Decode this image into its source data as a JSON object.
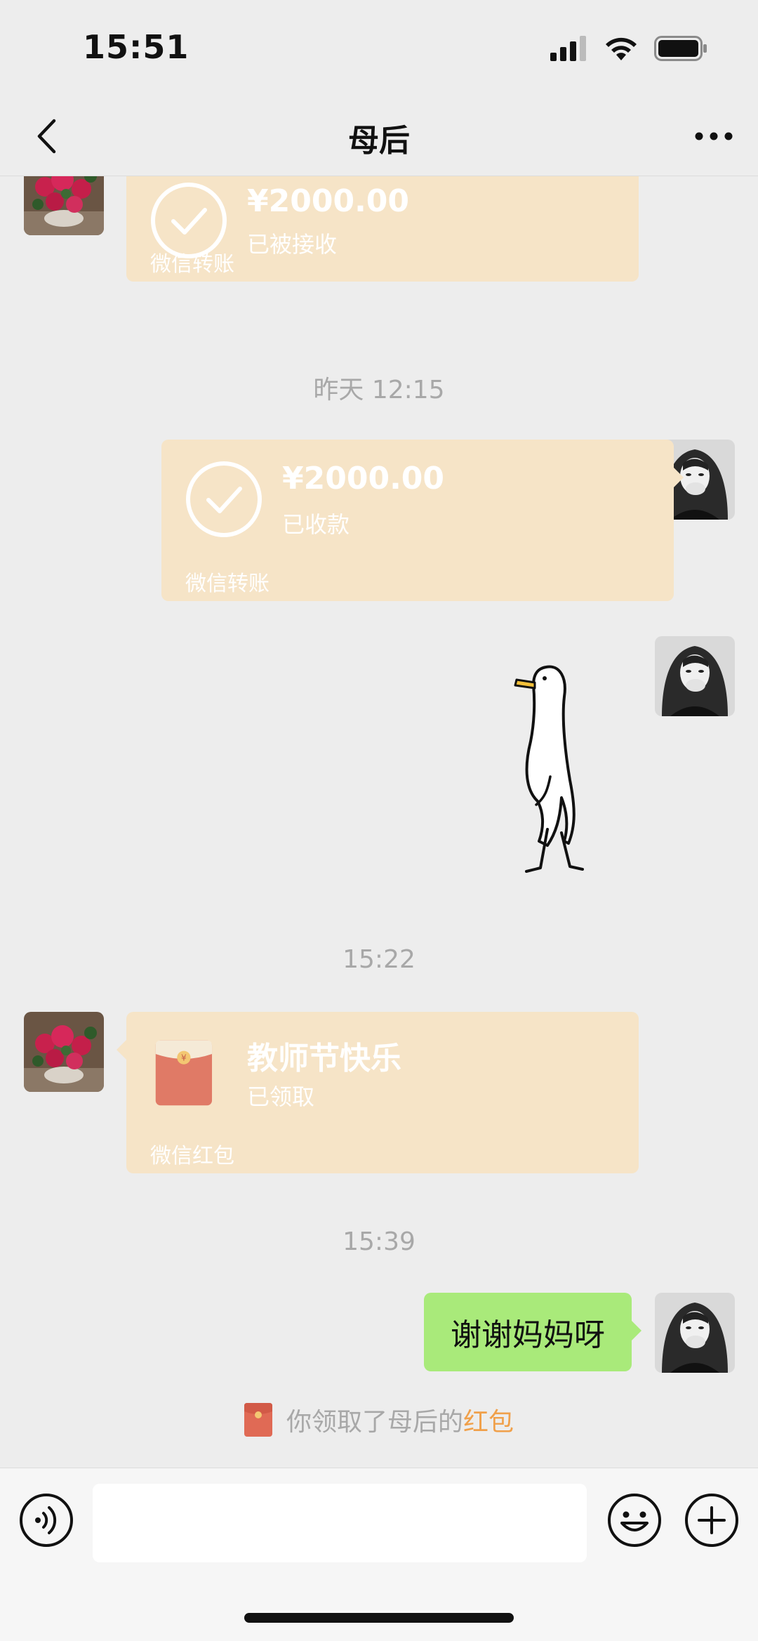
{
  "status_bar": {
    "time": "15:51"
  },
  "nav": {
    "title": "母后"
  },
  "messages": {
    "transfer_received_by_her": {
      "amount": "¥2000.00",
      "status": "已被接收",
      "footer": "微信转账"
    },
    "time_1": "昨天 12:15",
    "transfer_collected": {
      "amount": "¥2000.00",
      "status": "已收款",
      "footer": "微信转账"
    },
    "time_2": "15:22",
    "red_packet": {
      "title": "教师节快乐",
      "status": "已领取",
      "footer": "微信红包"
    },
    "time_3": "15:39",
    "text_reply": "谢谢妈妈呀",
    "system_notice": {
      "prefix": "你领取了母后的",
      "link": "红包"
    }
  },
  "colors": {
    "card_bg": "#f6e4c7",
    "green_bubble": "#a9ea7a",
    "link_orange": "#f0a04a",
    "red_packet": "#e07a66"
  },
  "icons": [
    "back-icon",
    "more-icon",
    "check-circle-icon",
    "red-packet-icon",
    "voice-icon",
    "emoji-icon",
    "plus-icon"
  ]
}
